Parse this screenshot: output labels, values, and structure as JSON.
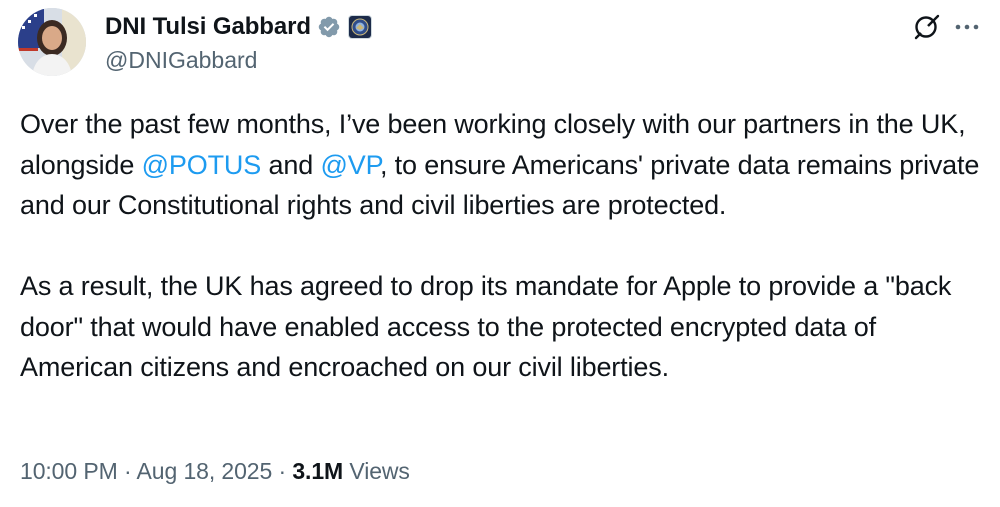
{
  "author": {
    "display_name": "DNI Tulsi Gabbard",
    "handle": "@DNIGabbard"
  },
  "icons": {
    "verified": "verified-badge-icon",
    "affiliate": "government-seal-icon",
    "grok": "grok-icon",
    "more": "more-options-icon"
  },
  "colors": {
    "accent": "#1d9bf0",
    "text": "#0f1419",
    "secondary": "#536471",
    "verified_badge": "#829aab"
  },
  "tweet": {
    "p1_part1": "Over the past few months, I’ve been working closely with our partners in the UK, alongside ",
    "mention1": "@POTUS",
    "p1_part2": " and ",
    "mention2": "@VP",
    "p1_part3": ", to ensure Americans' private data remains private and our Constitutional rights and civil liberties are protected.",
    "p2": "As a result, the UK has agreed to drop its mandate for Apple to provide a \"back door\" that would have enabled access to the protected encrypted data of American citizens and encroached on our civil liberties."
  },
  "meta": {
    "time": "10:00 PM",
    "separator": "·",
    "date": "Aug 18, 2025",
    "views_count": "3.1M",
    "views_label": "Views"
  }
}
